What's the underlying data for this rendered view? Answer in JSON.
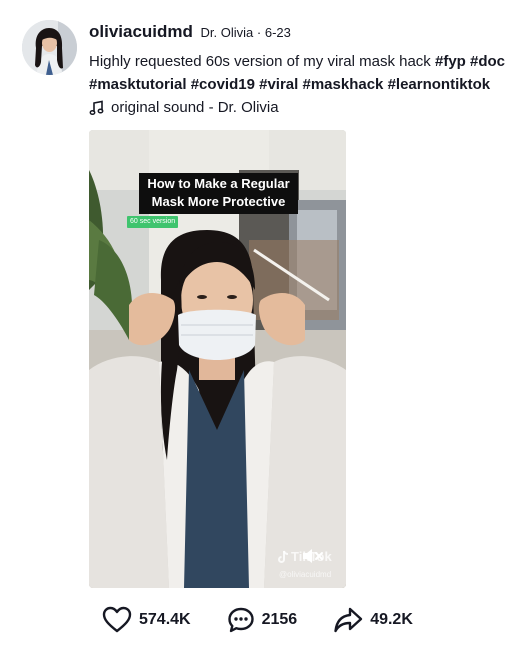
{
  "post": {
    "username": "oliviacuidmd",
    "display_name": "Dr. Olivia",
    "date": "6-23",
    "separator": "·",
    "caption_text": "Highly requested 60s version of my viral mask hack ",
    "hashtags_line1": [
      "#fyp",
      "#doc"
    ],
    "hashtags_line2": [
      "#masktutorial",
      "#covid19",
      "#viral",
      "#maskhack",
      "#learnontiktok"
    ],
    "sound": "original sound - Dr. Olivia"
  },
  "video": {
    "title_line1": "How to Make a Regular",
    "title_line2": "Mask More Protective",
    "badge": "60 sec version",
    "watermark": "TikTok",
    "watermark_user": "@oliviacuidmd"
  },
  "actions": {
    "likes": "574.4K",
    "comments": "2156",
    "shares": "49.2K"
  },
  "icons": {
    "like": "heart-icon",
    "comment": "comment-bubble-icon",
    "share": "share-arrow-icon",
    "sound": "music-note-icon",
    "mute": "muted-speaker-icon"
  }
}
